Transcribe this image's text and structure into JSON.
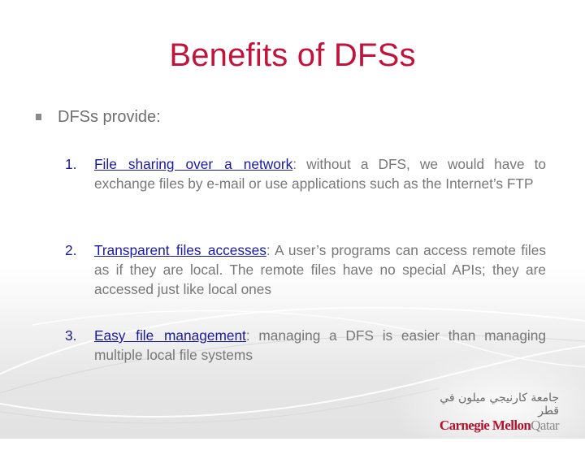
{
  "slide": {
    "title": "Benefits of DFSs",
    "bullet": "DFSs provide:",
    "items": [
      {
        "number": "1.",
        "link_text": "File sharing over a network",
        "text": ": without a DFS, we would have to exchange files by e-mail or use applications such as the Internet’s FTP"
      },
      {
        "number": "2.",
        "link_text": "Transparent files accesses",
        "text": ": A user’s programs can access remote files as if they are local. The remote files have no special APIs; they are accessed just like local ones"
      },
      {
        "number": "3.",
        "link_text": "Easy file management",
        "text": ": managing a DFS is easier than managing multiple local file systems"
      }
    ]
  },
  "logo": {
    "arabic": "جامعة كارنيجي ميلون في قطر",
    "name_primary": "Carnegie Mellon",
    "name_secondary": "Qatar"
  },
  "colors": {
    "title": "#c0143c",
    "body_text": "#777777",
    "link": "#1a1aa0",
    "logo_red": "#b3122e"
  }
}
